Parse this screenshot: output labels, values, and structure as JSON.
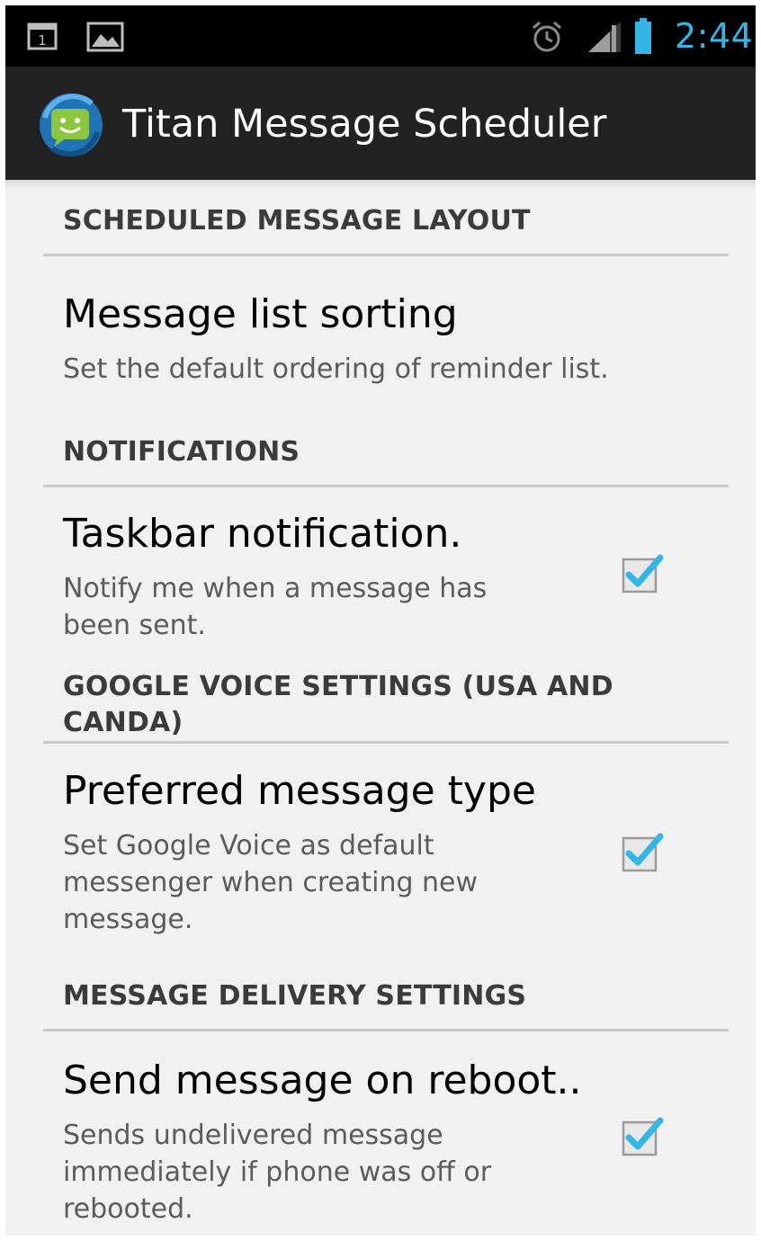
{
  "status_bar": {
    "time": "2:44",
    "icons": [
      "calendar-icon",
      "gallery-icon",
      "alarm-icon",
      "signal-icon",
      "battery-icon"
    ],
    "accent_color": "#33b5e5"
  },
  "action_bar": {
    "title": "Titan Message Scheduler",
    "app_icon": "app-logo-icon"
  },
  "sections": [
    {
      "header": "SCHEDULED MESSAGE LAYOUT",
      "items": [
        {
          "title": "Message list sorting",
          "summary": "Set the default ordering of reminder list."
        }
      ]
    },
    {
      "header": "NOTIFICATIONS",
      "items": [
        {
          "title": "Taskbar notification.",
          "summary": "Notify me when a message has been sent.",
          "checked": true
        }
      ]
    },
    {
      "header": "GOOGLE VOICE SETTINGS (USA AND CANDA)",
      "items": [
        {
          "title": "Preferred message type",
          "summary": "Set Google Voice as default messenger when creating new message.",
          "checked": true
        }
      ]
    },
    {
      "header": "MESSAGE DELIVERY SETTINGS",
      "items": [
        {
          "title": "Send message on reboot..",
          "summary": "Sends undelivered message immediately if phone was off or rebooted.",
          "checked": true
        }
      ]
    }
  ],
  "colors": {
    "checkbox_accent": "#33b5e5",
    "background": "#f1f1f1",
    "action_bar": "#222222"
  }
}
